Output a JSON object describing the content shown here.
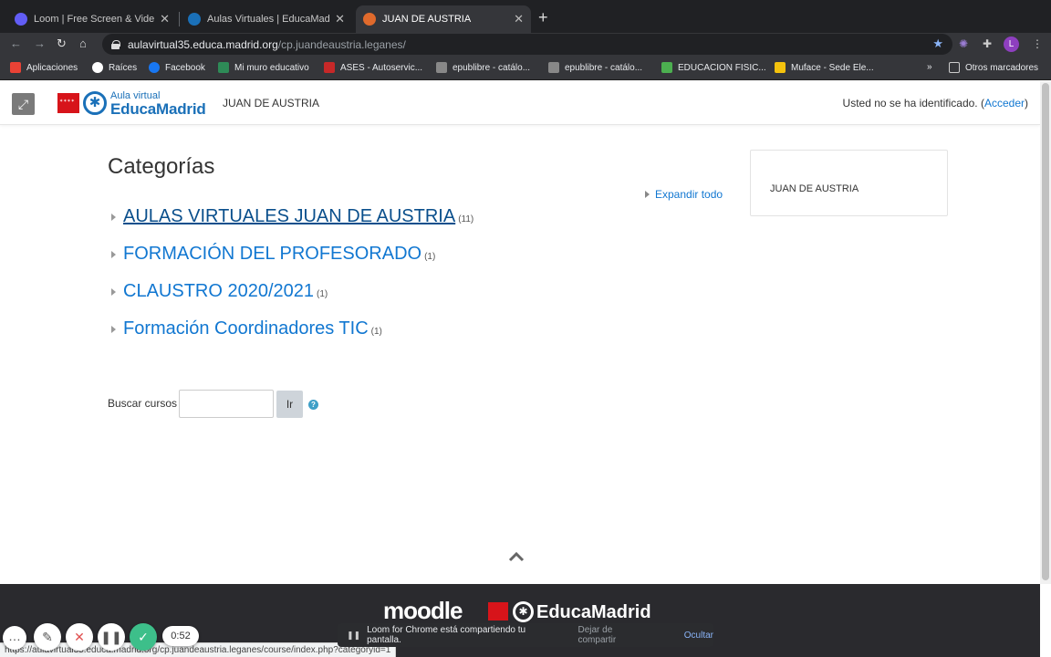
{
  "browser": {
    "tabs": [
      {
        "title": "Loom | Free Screen & Video Re",
        "favicon_color": "#625df5"
      },
      {
        "title": "Aulas Virtuales | EducaMadrid",
        "favicon_color": "#1a70b8"
      },
      {
        "title": "JUAN DE AUSTRIA",
        "favicon_color": "#e06a2c"
      }
    ],
    "url_host": "aulavirtual35.educa.madrid.org",
    "url_path": "/cp.juandeaustria.leganes/",
    "profile_initial": "L",
    "bookmarks": [
      {
        "label": "Aplicaciones",
        "color": "#e94235"
      },
      {
        "label": "Raíces",
        "color": "#ffffff"
      },
      {
        "label": "Facebook",
        "color": "#1877f2"
      },
      {
        "label": "Mi muro educativo",
        "color": "#2e8b57"
      },
      {
        "label": "ASES - Autoservic...",
        "color": "#c62828"
      },
      {
        "label": "epublibre - catálo...",
        "color": "#888888"
      },
      {
        "label": "epublibre - catálo...",
        "color": "#888888"
      },
      {
        "label": "EDUCACION FISIC...",
        "color": "#4caf50"
      },
      {
        "label": "Muface - Sede Ele...",
        "color": "#f4c20d"
      }
    ],
    "bookmarks_overflow": "»",
    "other_bookmarks": "Otros marcadores"
  },
  "header": {
    "logo_small": "Aula virtual",
    "logo_big": "EducaMadrid",
    "site_name": "JUAN DE AUSTRIA",
    "login_text": "Usted no se ha identificado. (",
    "login_link": "Acceder",
    "login_close": ")"
  },
  "main": {
    "title": "Categorías",
    "expand_all": "Expandir todo",
    "categories": [
      {
        "name": "AULAS VIRTUALES JUAN DE AUSTRIA",
        "count": "(11)"
      },
      {
        "name": "FORMACIÓN DEL PROFESORADO",
        "count": "(1)"
      },
      {
        "name": "CLAUSTRO 2020/2021",
        "count": "(1)"
      },
      {
        "name": "Formación Coordinadores TIC",
        "count": "(1)"
      }
    ],
    "search_label": "Buscar cursos",
    "search_button": "Ir",
    "help_glyph": "?"
  },
  "sidebar": {
    "block_text": "JUAN DE AUSTRIA"
  },
  "footer": {
    "moodle_logo": "moodle",
    "brand": "EducaMadrid"
  },
  "status_url": "https://aulavirtual35.educa.madrid.org/cp.juandeaustria.leganes/course/index.php?categoryid=1",
  "loom": {
    "timer": "0:52",
    "share_text": "Loom for Chrome está compartiendo tu pantalla.",
    "stop_sharing": "Dejar de compartir",
    "hide": "Ocultar"
  }
}
